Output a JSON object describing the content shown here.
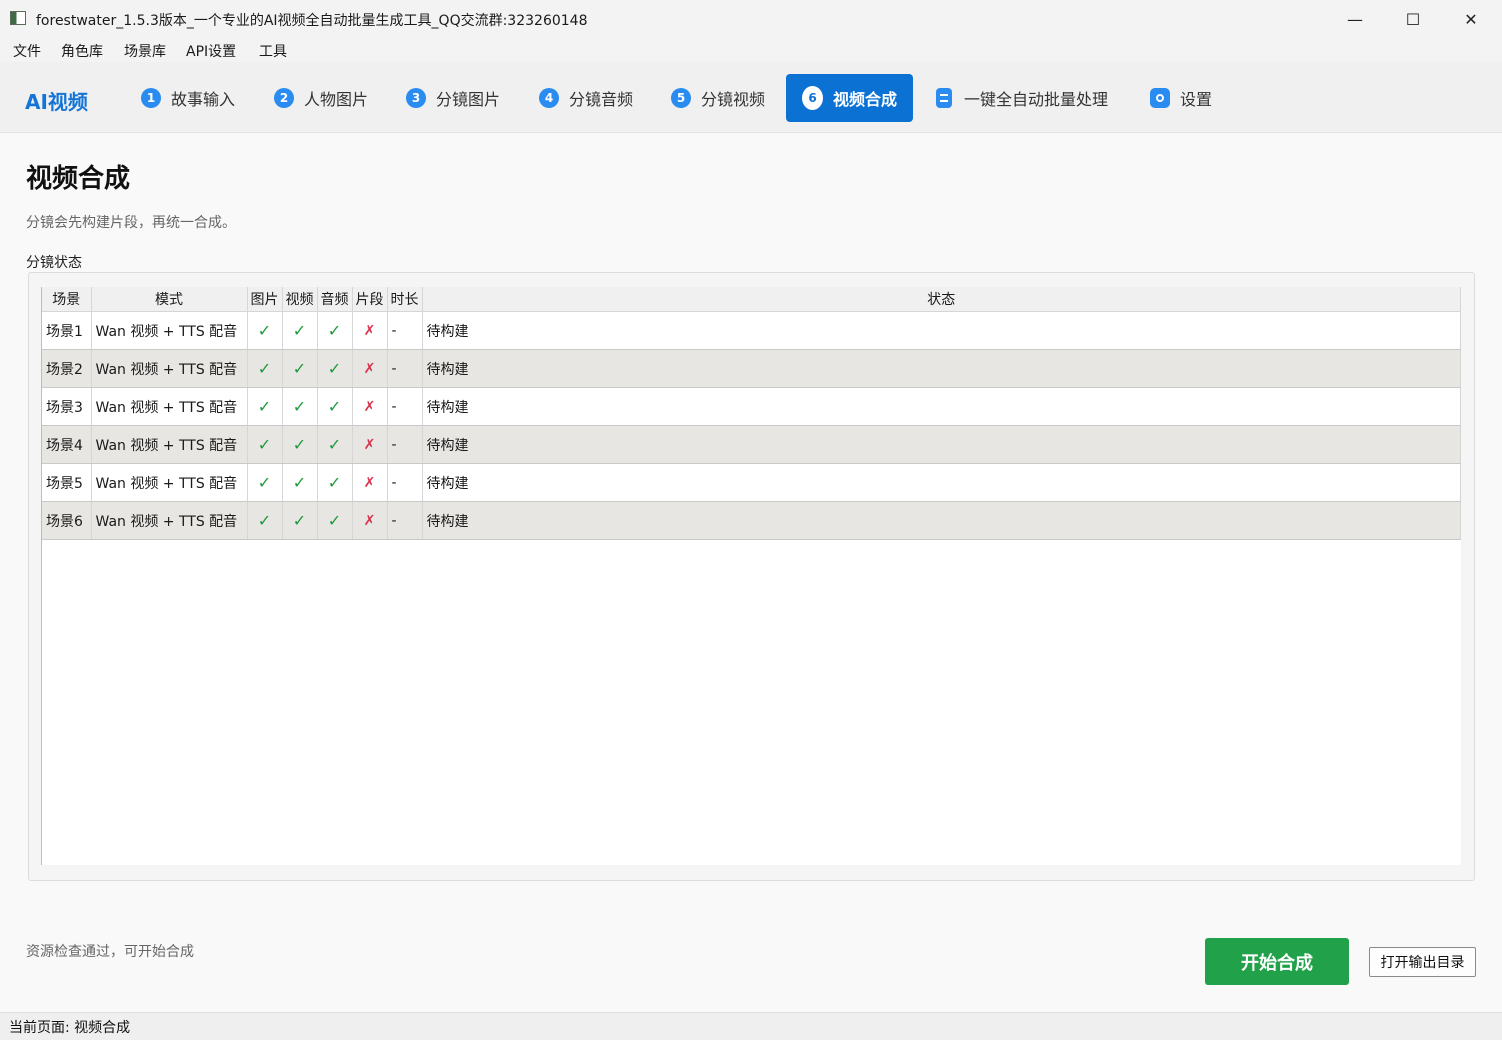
{
  "window": {
    "title": "forestwater_1.5.3版本_一个专业的AI视频全自动批量生成工具_QQ交流群:323260148",
    "minimize_glyph": "—",
    "maximize_glyph": "☐",
    "close_glyph": "✕"
  },
  "menu": [
    "文件",
    "角色库",
    "场景库",
    "API设置",
    "工具"
  ],
  "nav": {
    "brand": "AI视频",
    "tabs": [
      {
        "badge": "1",
        "label": "故事输入"
      },
      {
        "badge": "2",
        "label": "人物图片"
      },
      {
        "badge": "3",
        "label": "分镜图片"
      },
      {
        "badge": "4",
        "label": "分镜音频"
      },
      {
        "badge": "5",
        "label": "分镜视频"
      },
      {
        "badge": "6",
        "label": "视频合成",
        "active": true
      },
      {
        "icon": "document-icon",
        "label": "一键全自动批量处理"
      },
      {
        "icon": "gear-icon",
        "label": "设置"
      }
    ]
  },
  "page": {
    "title": "视频合成",
    "subtitle": "分镜会先构建片段，再统一合成。",
    "group_label": "分镜状态"
  },
  "table": {
    "columns": [
      "场景",
      "模式",
      "图片",
      "视频",
      "音频",
      "片段",
      "时长",
      "状态"
    ],
    "rows": [
      {
        "scene": "场景1",
        "mode": "Wan 视频 + TTS 配音",
        "image": "✓",
        "video": "✓",
        "audio": "✓",
        "clip": "✗",
        "duration": "-",
        "status": "待构建"
      },
      {
        "scene": "场景2",
        "mode": "Wan 视频 + TTS 配音",
        "image": "✓",
        "video": "✓",
        "audio": "✓",
        "clip": "✗",
        "duration": "-",
        "status": "待构建"
      },
      {
        "scene": "场景3",
        "mode": "Wan 视频 + TTS 配音",
        "image": "✓",
        "video": "✓",
        "audio": "✓",
        "clip": "✗",
        "duration": "-",
        "status": "待构建"
      },
      {
        "scene": "场景4",
        "mode": "Wan 视频 + TTS 配音",
        "image": "✓",
        "video": "✓",
        "audio": "✓",
        "clip": "✗",
        "duration": "-",
        "status": "待构建"
      },
      {
        "scene": "场景5",
        "mode": "Wan 视频 + TTS 配音",
        "image": "✓",
        "video": "✓",
        "audio": "✓",
        "clip": "✗",
        "duration": "-",
        "status": "待构建"
      },
      {
        "scene": "场景6",
        "mode": "Wan 视频 + TTS 配音",
        "image": "✓",
        "video": "✓",
        "audio": "✓",
        "clip": "✗",
        "duration": "-",
        "status": "待构建"
      }
    ]
  },
  "footer": {
    "status_message": "资源检查通过，可开始合成",
    "start_button": "开始合成",
    "open_dir_button": "打开输出目录"
  },
  "statusbar": {
    "text": "当前页面: 视频合成"
  },
  "colors": {
    "accent": "#0b72d4",
    "start_button": "#21a24a",
    "check": "#1e9a3c",
    "cross": "#d9304a"
  }
}
